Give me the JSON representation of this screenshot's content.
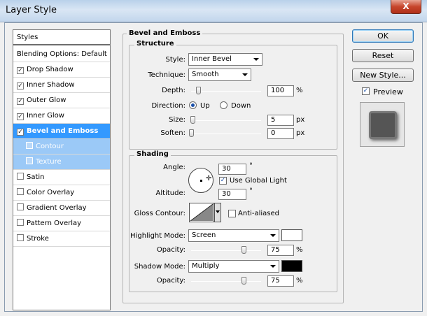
{
  "window": {
    "title": "Layer Style",
    "close_label": "X"
  },
  "left_panel": {
    "header": "Styles",
    "items": [
      {
        "label": "Blending Options: Default",
        "checkbox": false,
        "checked": false,
        "state": "normal"
      },
      {
        "label": "Drop Shadow",
        "checkbox": true,
        "checked": true,
        "state": "normal"
      },
      {
        "label": "Inner Shadow",
        "checkbox": true,
        "checked": true,
        "state": "normal"
      },
      {
        "label": "Outer Glow",
        "checkbox": true,
        "checked": true,
        "state": "normal"
      },
      {
        "label": "Inner Glow",
        "checkbox": true,
        "checked": true,
        "state": "normal"
      },
      {
        "label": "Bevel and Emboss",
        "checkbox": true,
        "checked": true,
        "state": "selected"
      },
      {
        "label": "Contour",
        "checkbox": true,
        "checked": false,
        "state": "sub"
      },
      {
        "label": "Texture",
        "checkbox": true,
        "checked": false,
        "state": "sub"
      },
      {
        "label": "Satin",
        "checkbox": true,
        "checked": false,
        "state": "normal"
      },
      {
        "label": "Color Overlay",
        "checkbox": true,
        "checked": false,
        "state": "normal"
      },
      {
        "label": "Gradient Overlay",
        "checkbox": true,
        "checked": false,
        "state": "normal"
      },
      {
        "label": "Pattern Overlay",
        "checkbox": true,
        "checked": false,
        "state": "normal"
      },
      {
        "label": "Stroke",
        "checkbox": true,
        "checked": false,
        "state": "normal"
      }
    ]
  },
  "bevel": {
    "title": "Bevel and Emboss",
    "structure": {
      "title": "Structure",
      "style_label": "Style:",
      "style_value": "Inner Bevel",
      "technique_label": "Technique:",
      "technique_value": "Smooth",
      "depth_label": "Depth:",
      "depth_value": "100",
      "depth_unit": "%",
      "depth_level": 0.1,
      "direction_label": "Direction:",
      "direction_up": "Up",
      "direction_down": "Down",
      "size_label": "Size:",
      "size_value": "5",
      "size_unit": "px",
      "size_level": 0.02,
      "soften_label": "Soften:",
      "soften_value": "0",
      "soften_unit": "px",
      "soften_level": 0.0
    },
    "shading": {
      "title": "Shading",
      "angle_label": "Angle:",
      "angle_value": "30",
      "angle_unit": "°",
      "global_light_label": "Use Global Light",
      "altitude_label": "Altitude:",
      "altitude_value": "30",
      "altitude_unit": "°",
      "gloss_label": "Gloss Contour:",
      "anti_aliased_label": "Anti-aliased",
      "highlight_mode_label": "Highlight Mode:",
      "highlight_mode_value": "Screen",
      "highlight_color": "#ffffff",
      "highlight_opacity_label": "Opacity:",
      "highlight_opacity_value": "75",
      "highlight_opacity_unit": "%",
      "highlight_opacity_level": 0.75,
      "shadow_mode_label": "Shadow Mode:",
      "shadow_mode_value": "Multiply",
      "shadow_color": "#000000",
      "shadow_opacity_label": "Opacity:",
      "shadow_opacity_value": "75",
      "shadow_opacity_unit": "%",
      "shadow_opacity_level": 0.75
    }
  },
  "buttons": {
    "ok": "OK",
    "reset": "Reset",
    "new_style": "New Style...",
    "preview": "Preview"
  }
}
